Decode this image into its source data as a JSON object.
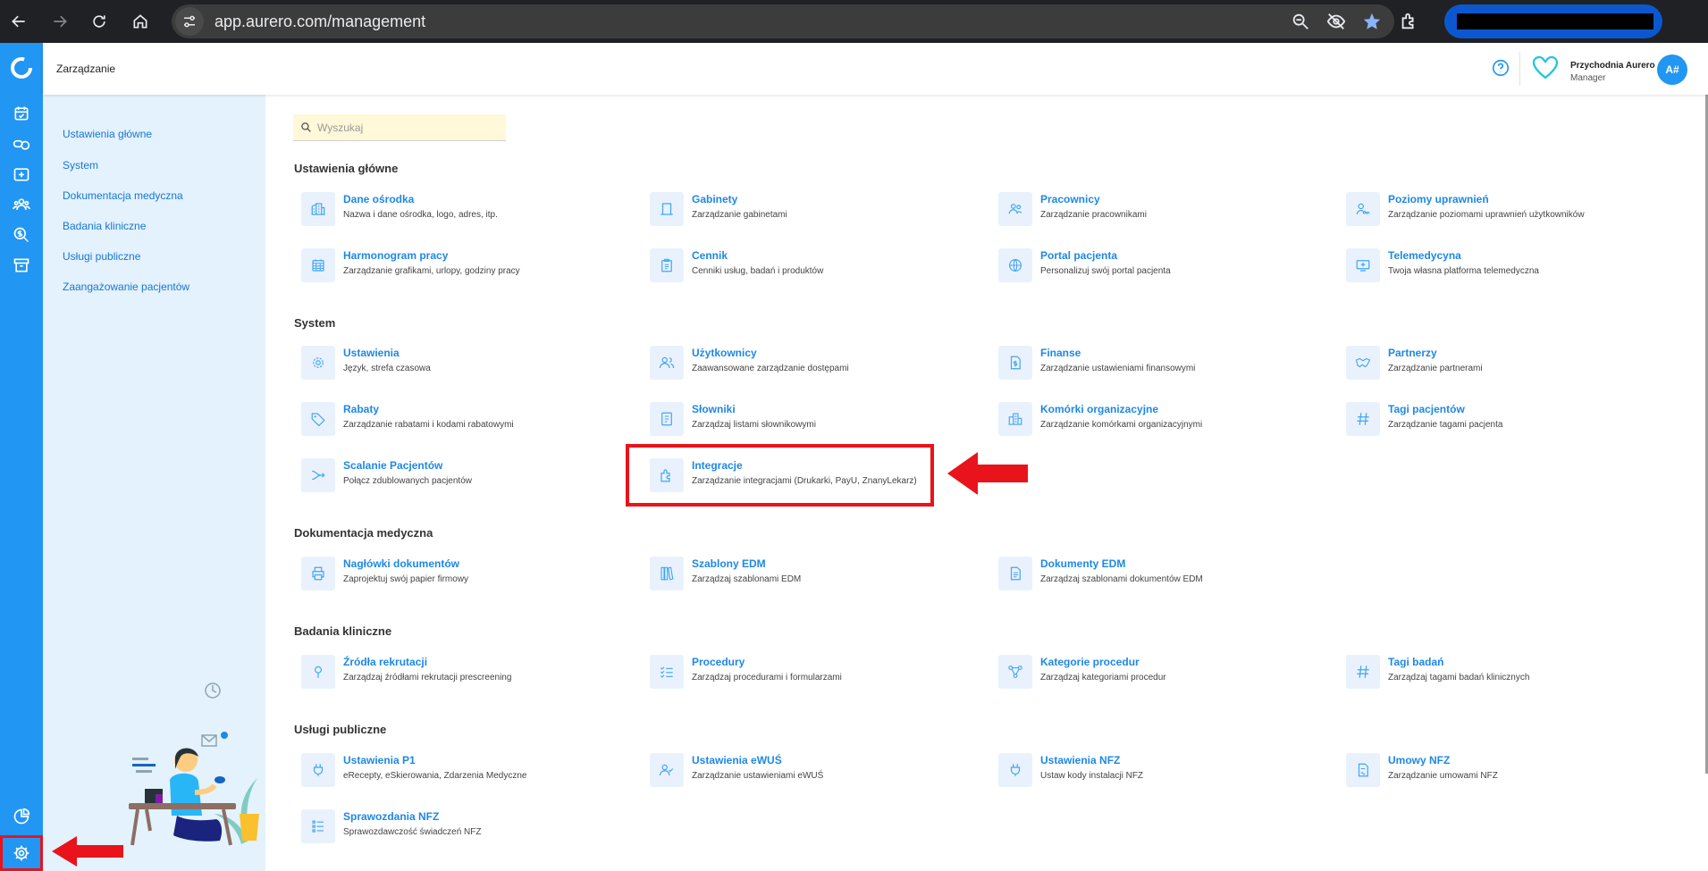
{
  "browser": {
    "url": "app.aurero.com/management"
  },
  "app": {
    "page_title": "Zarządzanie",
    "help_icon": "help-circle-icon",
    "clinic_name": "Przychodnia Aurero",
    "clinic_role": "Manager",
    "avatar_initials": "A#",
    "accent_color": "#2196f3",
    "highlight_color": "#e8131b"
  },
  "rail": {
    "items": [
      "calendar-icon",
      "pills-icon",
      "medical-plus-icon",
      "users-icon",
      "finance-search-icon",
      "archive-icon"
    ],
    "bottom_items": [
      "pie-chart-icon",
      "settings-gear-icon"
    ]
  },
  "subnav": {
    "items": [
      {
        "label": "Ustawienia główne"
      },
      {
        "label": "System"
      },
      {
        "label": "Dokumentacja medyczna"
      },
      {
        "label": "Badania kliniczne"
      },
      {
        "label": "Usługi publiczne"
      },
      {
        "label": "Zaangażowanie pacjentów"
      }
    ]
  },
  "search": {
    "placeholder": "Wyszukaj"
  },
  "sections": [
    {
      "title": "Ustawienia główne",
      "tiles": [
        {
          "title": "Dane ośrodka",
          "desc": "Nazwa i dane ośrodka, logo, adres, itp.",
          "icon": "building-icon"
        },
        {
          "title": "Gabinety",
          "desc": "Zarządzanie gabinetami",
          "icon": "door-icon"
        },
        {
          "title": "Pracownicy",
          "desc": "Zarządzanie pracownikami",
          "icon": "staff-icon"
        },
        {
          "title": "Poziomy uprawnień",
          "desc": "Zarządzanie poziomami uprawnień użytkowników",
          "icon": "user-key-icon"
        },
        {
          "title": "Harmonogram pracy",
          "desc": "Zarządzanie grafikami, urlopy, godziny pracy",
          "icon": "calendar-grid-icon"
        },
        {
          "title": "Cennik",
          "desc": "Cenniki usług, badań i produktów",
          "icon": "clipboard-list-icon"
        },
        {
          "title": "Portal pacjenta",
          "desc": "Personalizuj swój portal pacjenta",
          "icon": "globe-icon"
        },
        {
          "title": "Telemedycyna",
          "desc": "Twoja własna platforma telemedyczna",
          "icon": "monitor-plus-icon"
        }
      ]
    },
    {
      "title": "System",
      "tiles": [
        {
          "title": "Ustawienia",
          "desc": "Język, strefa czasowa",
          "icon": "gear-icon"
        },
        {
          "title": "Użytkownicy",
          "desc": "Zaawansowane zarządzanie dostępami",
          "icon": "users-icon"
        },
        {
          "title": "Finanse",
          "desc": "Zarządzanie ustawieniami finansowymi",
          "icon": "dollar-document-icon"
        },
        {
          "title": "Partnerzy",
          "desc": "Zarządzanie partnerami",
          "icon": "handshake-icon"
        },
        {
          "title": "Rabaty",
          "desc": "Zarządzanie rabatami i kodami rabatowymi",
          "icon": "tag-icon"
        },
        {
          "title": "Słowniki",
          "desc": "Zarządzaj listami słownikowymi",
          "icon": "book-icon"
        },
        {
          "title": "Komórki organizacyjne",
          "desc": "Zarządzanie komórkami organizacyjnymi",
          "icon": "buildings-icon"
        },
        {
          "title": "Tagi pacjentów",
          "desc": "Zarządzanie tagami pacjenta",
          "icon": "hash-icon"
        },
        {
          "title": "Scalanie Pacjentów",
          "desc": "Połącz zdublowanych pacjentów",
          "icon": "merge-arrow-icon"
        },
        {
          "title": "Integracje",
          "desc": "Zarządzanie integracjami (Drukarki, PayU, ZnanyLekarz)",
          "icon": "puzzle-icon"
        }
      ]
    },
    {
      "title": "Dokumentacja medyczna",
      "tiles": [
        {
          "title": "Nagłówki dokumentów",
          "desc": "Zaprojektuj swój papier firmowy",
          "icon": "printer-icon"
        },
        {
          "title": "Szablony EDM",
          "desc": "Zarządzaj szablonami EDM",
          "icon": "books-icon"
        },
        {
          "title": "Dokumenty EDM",
          "desc": "Zarządzaj szablonami dokumentów EDM",
          "icon": "document-icon"
        }
      ]
    },
    {
      "title": "Badania kliniczne",
      "tiles": [
        {
          "title": "Źródła rekrutacji",
          "desc": "Zarządzaj źródłami rekrutacji prescreening",
          "icon": "pin-icon"
        },
        {
          "title": "Procedury",
          "desc": "Zarządzaj procedurami i formularzami",
          "icon": "checklist-icon"
        },
        {
          "title": "Kategorie procedur",
          "desc": "Zarządzaj kategoriami procedur",
          "icon": "nodes-icon"
        },
        {
          "title": "Tagi badań",
          "desc": "Zarządzaj tagami badań klinicznych",
          "icon": "hash-icon"
        }
      ]
    },
    {
      "title": "Usługi publiczne",
      "tiles": [
        {
          "title": "Ustawienia P1",
          "desc": "eRecepty, eSkierowania, Zdarzenia Medyczne",
          "icon": "plug-icon"
        },
        {
          "title": "Ustawienia eWUŚ",
          "desc": "Zarządzanie ustawieniami eWUŚ",
          "icon": "user-check-icon"
        },
        {
          "title": "Ustawienia NFZ",
          "desc": "Ustaw kody instalacji NFZ",
          "icon": "plug-icon"
        },
        {
          "title": "Umowy NFZ",
          "desc": "Zarządzanie umowami NFZ",
          "icon": "contract-icon"
        },
        {
          "title": "Sprawozdania NFZ",
          "desc": "Sprawozdawczość świadczeń NFZ",
          "icon": "report-list-icon"
        }
      ]
    }
  ]
}
